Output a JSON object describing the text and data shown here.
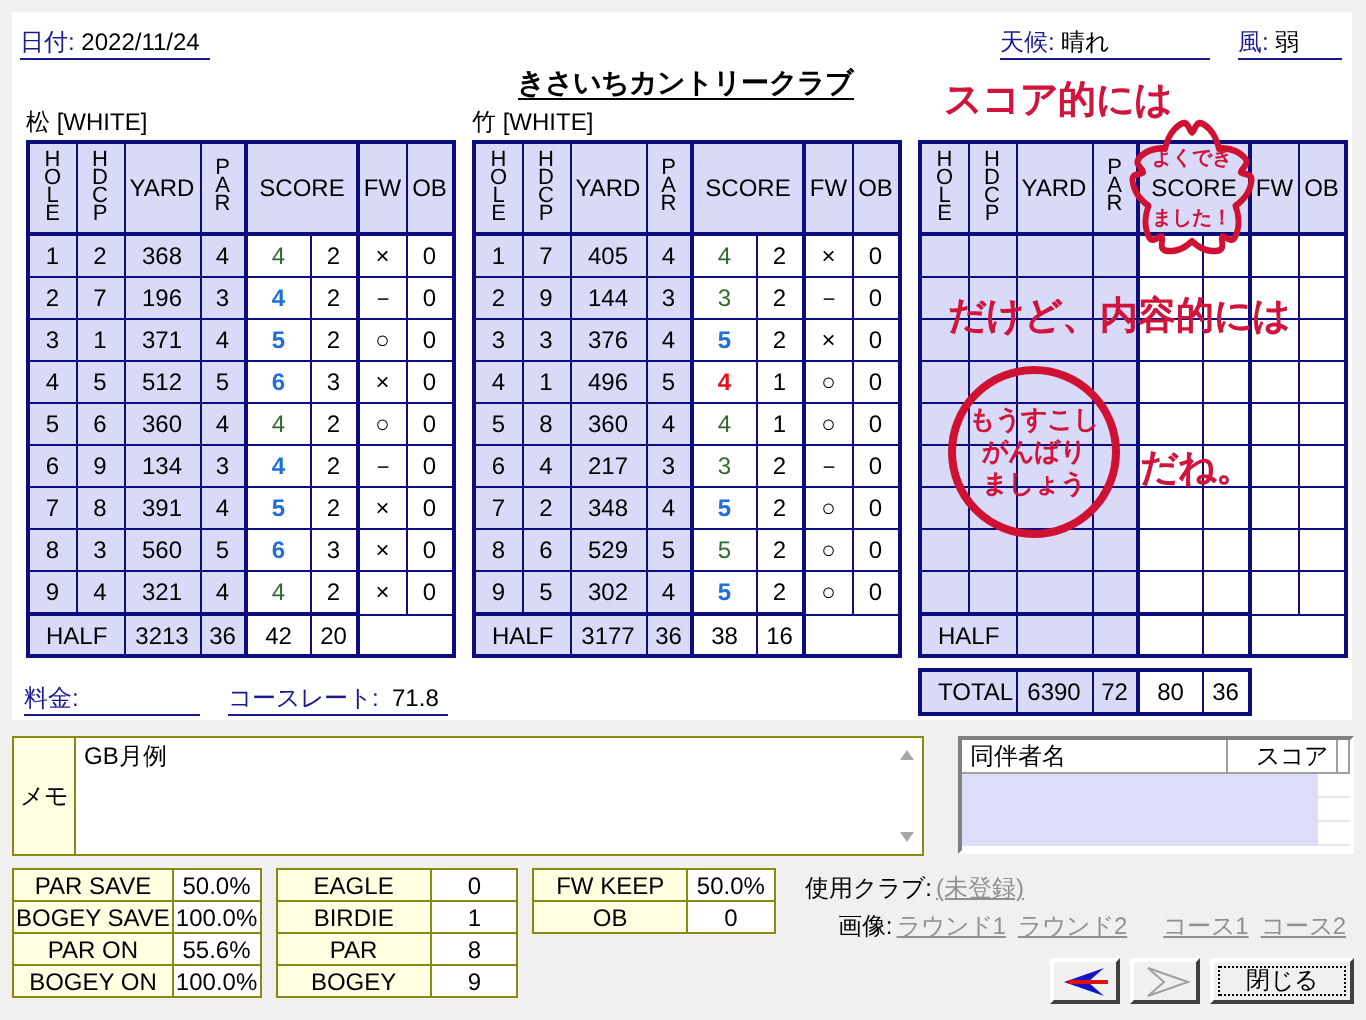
{
  "header": {
    "date_label": "日付:",
    "date": "2022/11/24",
    "title": "きさいちカントリークラブ",
    "weather_label": "天候:",
    "weather": "晴れ",
    "wind_label": "風:",
    "wind": "弱"
  },
  "cards": [
    {
      "kind": "filled",
      "name": "松 [WHITE]",
      "headers": [
        "HOLE",
        "HDCP",
        "YARD",
        "PAR",
        "SCORE",
        "FW",
        "OB"
      ],
      "holes": [
        {
          "hole": "1",
          "hdcp": "2",
          "yard": "368",
          "par": "4",
          "score": "4",
          "color": "#2f6a2f",
          "bold": false,
          "putts": "2",
          "fw": "×",
          "ob": "0"
        },
        {
          "hole": "2",
          "hdcp": "7",
          "yard": "196",
          "par": "3",
          "score": "4",
          "color": "#1e6fdc",
          "bold": true,
          "putts": "2",
          "fw": "－",
          "ob": "0"
        },
        {
          "hole": "3",
          "hdcp": "1",
          "yard": "371",
          "par": "4",
          "score": "5",
          "color": "#1e6fdc",
          "bold": true,
          "putts": "2",
          "fw": "○",
          "ob": "0"
        },
        {
          "hole": "4",
          "hdcp": "5",
          "yard": "512",
          "par": "5",
          "score": "6",
          "color": "#1e6fdc",
          "bold": true,
          "putts": "3",
          "fw": "×",
          "ob": "0"
        },
        {
          "hole": "5",
          "hdcp": "6",
          "yard": "360",
          "par": "4",
          "score": "4",
          "color": "#2f6a2f",
          "bold": false,
          "putts": "2",
          "fw": "○",
          "ob": "0"
        },
        {
          "hole": "6",
          "hdcp": "9",
          "yard": "134",
          "par": "3",
          "score": "4",
          "color": "#1e6fdc",
          "bold": true,
          "putts": "2",
          "fw": "－",
          "ob": "0"
        },
        {
          "hole": "7",
          "hdcp": "8",
          "yard": "391",
          "par": "4",
          "score": "5",
          "color": "#1e6fdc",
          "bold": true,
          "putts": "2",
          "fw": "×",
          "ob": "0"
        },
        {
          "hole": "8",
          "hdcp": "3",
          "yard": "560",
          "par": "5",
          "score": "6",
          "color": "#1e6fdc",
          "bold": true,
          "putts": "3",
          "fw": "×",
          "ob": "0"
        },
        {
          "hole": "9",
          "hdcp": "4",
          "yard": "321",
          "par": "4",
          "score": "4",
          "color": "#2f6a2f",
          "bold": false,
          "putts": "2",
          "fw": "×",
          "ob": "0"
        }
      ],
      "half": {
        "label": "HALF",
        "yard": "3213",
        "par": "36",
        "score": "42",
        "putts": "20"
      }
    },
    {
      "kind": "filled",
      "name": "竹 [WHITE]",
      "headers": [
        "HOLE",
        "HDCP",
        "YARD",
        "PAR",
        "SCORE",
        "FW",
        "OB"
      ],
      "holes": [
        {
          "hole": "1",
          "hdcp": "7",
          "yard": "405",
          "par": "4",
          "score": "4",
          "color": "#2f6a2f",
          "bold": false,
          "putts": "2",
          "fw": "×",
          "ob": "0"
        },
        {
          "hole": "2",
          "hdcp": "9",
          "yard": "144",
          "par": "3",
          "score": "3",
          "color": "#2f6a2f",
          "bold": false,
          "putts": "2",
          "fw": "－",
          "ob": "0"
        },
        {
          "hole": "3",
          "hdcp": "3",
          "yard": "376",
          "par": "4",
          "score": "5",
          "color": "#1e6fdc",
          "bold": true,
          "putts": "2",
          "fw": "×",
          "ob": "0"
        },
        {
          "hole": "4",
          "hdcp": "1",
          "yard": "496",
          "par": "5",
          "score": "4",
          "color": "#e3121b",
          "bold": true,
          "putts": "1",
          "fw": "○",
          "ob": "0"
        },
        {
          "hole": "5",
          "hdcp": "8",
          "yard": "360",
          "par": "4",
          "score": "4",
          "color": "#2f6a2f",
          "bold": false,
          "putts": "1",
          "fw": "○",
          "ob": "0"
        },
        {
          "hole": "6",
          "hdcp": "4",
          "yard": "217",
          "par": "3",
          "score": "3",
          "color": "#2f6a2f",
          "bold": false,
          "putts": "2",
          "fw": "－",
          "ob": "0"
        },
        {
          "hole": "7",
          "hdcp": "2",
          "yard": "348",
          "par": "4",
          "score": "5",
          "color": "#1e6fdc",
          "bold": true,
          "putts": "2",
          "fw": "○",
          "ob": "0"
        },
        {
          "hole": "8",
          "hdcp": "6",
          "yard": "529",
          "par": "5",
          "score": "5",
          "color": "#2f6a2f",
          "bold": false,
          "putts": "2",
          "fw": "○",
          "ob": "0"
        },
        {
          "hole": "9",
          "hdcp": "5",
          "yard": "302",
          "par": "4",
          "score": "5",
          "color": "#1e6fdc",
          "bold": true,
          "putts": "2",
          "fw": "○",
          "ob": "0"
        }
      ],
      "half": {
        "label": "HALF",
        "yard": "3177",
        "par": "36",
        "score": "38",
        "putts": "16"
      }
    },
    {
      "kind": "blank",
      "headers": [
        "HOLE",
        "HDCP",
        "YARD",
        "PAR",
        "SCORE",
        "FW",
        "OB"
      ],
      "half": {
        "label": "HALF"
      }
    }
  ],
  "total": {
    "label": "TOTAL",
    "yard": "6390",
    "par": "72",
    "score": "80",
    "putts": "36"
  },
  "annotations": [
    {
      "kind": "caption",
      "lines": [
        "スコア的には"
      ]
    },
    {
      "kind": "flower",
      "lines": [
        "よくでき",
        "ました！"
      ]
    },
    {
      "kind": "caption",
      "lines": [
        "だけど、内容的には"
      ]
    },
    {
      "kind": "circle",
      "lines": [
        "もうすこし",
        "がんばり",
        "ましょう"
      ]
    },
    {
      "kind": "caption",
      "lines": [
        "だね。"
      ]
    }
  ],
  "fee": {
    "fee_label": "料金:",
    "rate_label": "コースレート:",
    "rate": "71.8"
  },
  "memo": {
    "label": "メモ",
    "text": "GB月例"
  },
  "companions": {
    "columns": [
      "同伴者名",
      "スコア"
    ]
  },
  "stats": [
    [
      {
        "label": "PAR SAVE",
        "value": "50.0%"
      },
      {
        "label": "BOGEY SAVE",
        "value": "100.0%"
      },
      {
        "label": "PAR ON",
        "value": "55.6%"
      },
      {
        "label": "BOGEY ON",
        "value": "100.0%"
      }
    ],
    [
      {
        "label": "EAGLE",
        "value": "0"
      },
      {
        "label": "BIRDIE",
        "value": "1"
      },
      {
        "label": "PAR",
        "value": "8"
      },
      {
        "label": "BOGEY",
        "value": "9"
      }
    ],
    [
      {
        "label": "FW KEEP",
        "value": "50.0%"
      },
      {
        "label": "OB",
        "value": "0"
      }
    ]
  ],
  "club": {
    "label": "使用クラブ:",
    "value": "(未登録)"
  },
  "images": {
    "label": "画像:",
    "links": [
      "ラウンド1",
      "ラウンド2",
      "コース1",
      "コース2"
    ]
  },
  "buttons": [
    {
      "kind": "prev",
      "disabled": false
    },
    {
      "kind": "next",
      "disabled": true
    },
    {
      "kind": "close",
      "label": "閉じる",
      "disabled": false
    }
  ]
}
